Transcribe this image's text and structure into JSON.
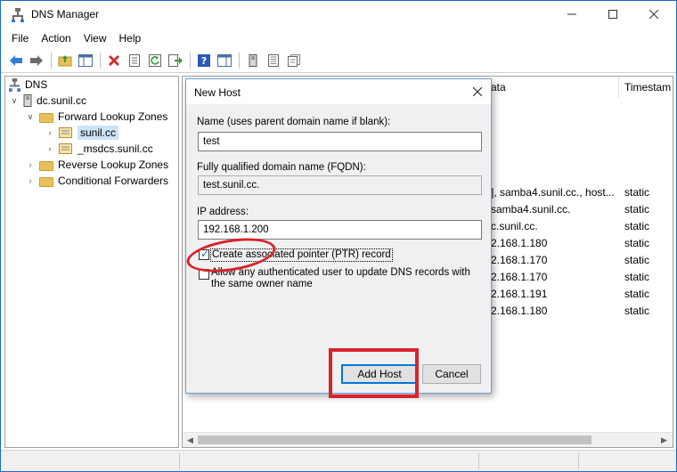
{
  "window": {
    "title": "DNS Manager"
  },
  "menu": [
    "File",
    "Action",
    "View",
    "Help"
  ],
  "tree": {
    "root": "DNS",
    "server": "dc.sunil.cc",
    "forward_zones": "Forward Lookup Zones",
    "zone_selected": "sunil.cc",
    "zone_msdcs": "_msdcs.sunil.cc",
    "reverse_zones": "Reverse Lookup Zones",
    "conditional_forwarders": "Conditional Forwarders"
  },
  "list": {
    "col_data_partial": "ata",
    "col_timestamp": "Timestam",
    "rows": [
      {
        "data": "], samba4.sunil.cc., host...",
        "timestamp": "static"
      },
      {
        "data": "samba4.sunil.cc.",
        "timestamp": "static"
      },
      {
        "data": "c.sunil.cc.",
        "timestamp": "static"
      },
      {
        "data": "2.168.1.180",
        "timestamp": "static"
      },
      {
        "data": "2.168.1.170",
        "timestamp": "static"
      },
      {
        "data": "2.168.1.170",
        "timestamp": "static"
      },
      {
        "data": "2.168.1.191",
        "timestamp": "static"
      },
      {
        "data": "2.168.1.180",
        "timestamp": "static"
      }
    ]
  },
  "dialog": {
    "title": "New Host",
    "name_label": "Name (uses parent domain name if blank):",
    "name_value": "test",
    "fqdn_label": "Fully qualified domain name (FQDN):",
    "fqdn_value": "test.sunil.cc.",
    "ip_label": "IP address:",
    "ip_value": "192.168.1.200",
    "ptr_checkbox": {
      "label": "Create associated pointer (PTR) record",
      "checked": true
    },
    "auth_checkbox": {
      "label": "Allow any authenticated user to update DNS records with the same owner name",
      "checked": false
    },
    "add_button": "Add Host",
    "cancel_button": "Cancel"
  },
  "colors": {
    "annotation": "#d8242c",
    "accent": "#0078d7",
    "folder": "#e8c15a"
  }
}
